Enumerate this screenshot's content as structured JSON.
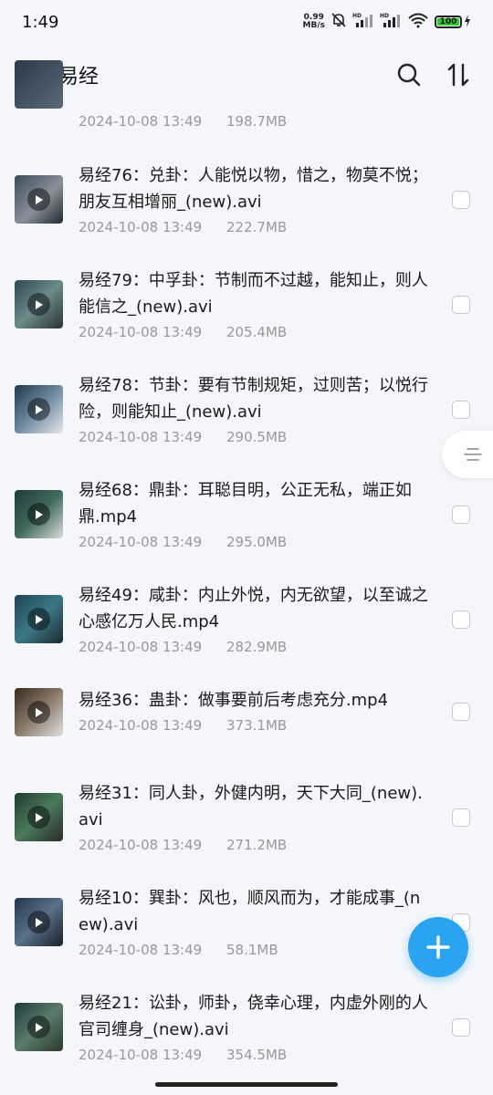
{
  "status_bar": {
    "time": "1:49",
    "net_speed_value": "0.99",
    "net_speed_unit": "MB/s",
    "signal1_label": "HD",
    "signal2_label": "HD",
    "battery": "100"
  },
  "header": {
    "title": "易经"
  },
  "items": [
    {
      "name": "",
      "date": "2024-10-08 13:49",
      "size": "198.7MB"
    },
    {
      "name": "易经76：兑卦：人能悦以物，惜之，物莫不悦；朋友互相增丽_(new).avi",
      "date": "2024-10-08 13:49",
      "size": "222.7MB"
    },
    {
      "name": "易经79：中孚卦：节制而不过越，能知止，则人能信之_(new).avi",
      "date": "2024-10-08 13:49",
      "size": "205.4MB"
    },
    {
      "name": "易经78：节卦：要有节制规矩，过则苦；以悦行险，则能知止_(new).avi",
      "date": "2024-10-08 13:49",
      "size": "290.5MB"
    },
    {
      "name": "易经68：鼎卦：耳聪目明，公正无私，端正如鼎.mp4",
      "date": "2024-10-08 13:49",
      "size": "295.0MB"
    },
    {
      "name": "易经49：咸卦：内止外悦，内无欲望，以至诚之心感亿万人民.mp4",
      "date": "2024-10-08 13:49",
      "size": "282.9MB"
    },
    {
      "name": "易经36：蛊卦：做事要前后考虑充分.mp4",
      "date": "2024-10-08 13:49",
      "size": "373.1MB"
    },
    {
      "name": "易经31：同人卦，外健内明，天下大同_(new).avi",
      "date": "2024-10-08 13:49",
      "size": "271.2MB"
    },
    {
      "name": "易经10：巽卦：风也，顺风而为，才能成事_(new).avi",
      "date": "2024-10-08 13:49",
      "size": "58.1MB"
    },
    {
      "name": "易经21：讼卦，师卦，侥幸心理，内虚外刚的人官司缠身_(new).avi",
      "date": "2024-10-08 13:49",
      "size": "354.5MB"
    }
  ],
  "colors": {
    "accent": "#2aa4f0",
    "battery": "#2ec82e"
  }
}
